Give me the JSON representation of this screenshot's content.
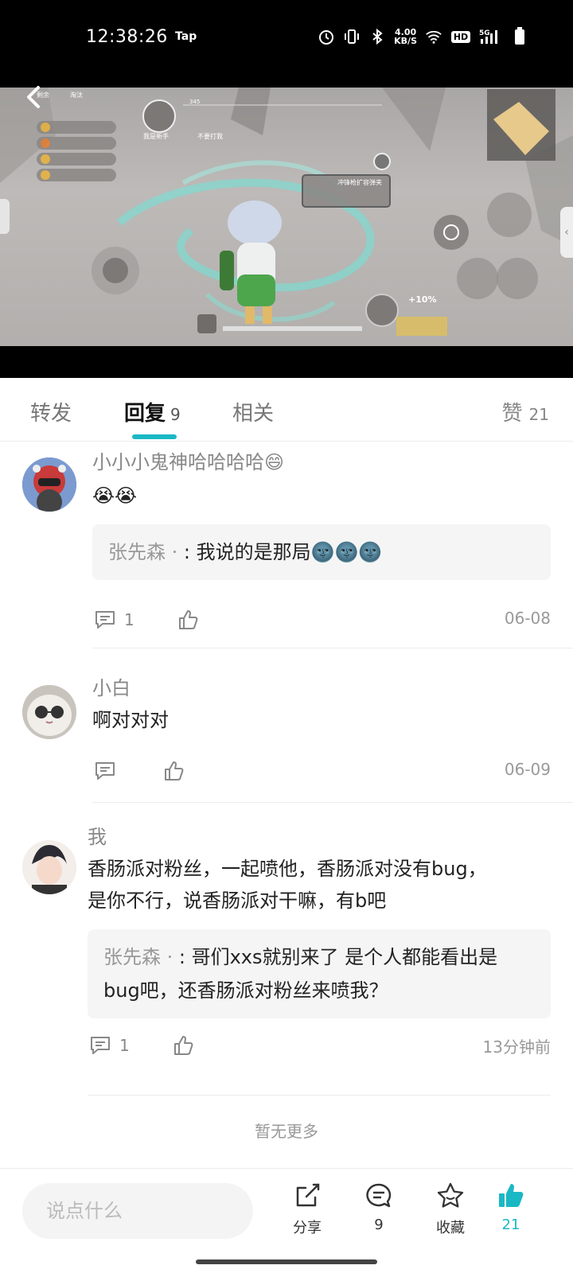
{
  "status_bar": {
    "time": "12:38:26",
    "app_tag": "Tap",
    "net_speed_value": "4.00",
    "net_speed_unit": "KB/S",
    "hd_label": "HD",
    "network": "5G"
  },
  "video": {
    "hud_text": {
      "remaining": "剩余",
      "eliminated": "淘汰",
      "top_counts": "345",
      "player_tag": "我是新手",
      "teammate": "不要打我",
      "pickup": "冲锋枪扩容弹夹",
      "bonus": "+10%"
    }
  },
  "tabs": {
    "items": [
      {
        "label": "转发",
        "count": ""
      },
      {
        "label": "回复",
        "count": "9"
      },
      {
        "label": "相关",
        "count": ""
      }
    ],
    "likes_label": "赞",
    "likes_count": "21"
  },
  "comments": [
    {
      "name": "小小小鬼神哈哈哈哈😄",
      "text": "😭😭",
      "reply_name": "张先森 · ",
      "reply_text": ": 我说的是那局🌚🌚🌚",
      "reply_count": "1",
      "date": "06-08"
    },
    {
      "name": "小白",
      "text": "啊对对对",
      "reply_count": "",
      "date": "06-09"
    },
    {
      "name": "我",
      "text_line1": "香肠派对粉丝，一起喷他，香肠派对没有bug，",
      "text_line2": "是你不行，说香肠派对干嘛，有b吧",
      "reply_name": "张先森 · ",
      "reply_text_line1": ": 哥们xxs就别来了 是个人都能看出是",
      "reply_text_line2": "bug吧，还香肠派对粉丝来喷我？",
      "reply_count": "1",
      "date": "13分钟前"
    }
  ],
  "no_more": "暂无更多",
  "bottom_bar": {
    "input_placeholder": "说点什么",
    "share_label": "分享",
    "comment_count": "9",
    "favorite_label": "收藏",
    "like_count": "21"
  },
  "colors": {
    "accent": "#1ab8c4",
    "muted_text": "#888888",
    "reply_bg": "#f5f5f5"
  }
}
